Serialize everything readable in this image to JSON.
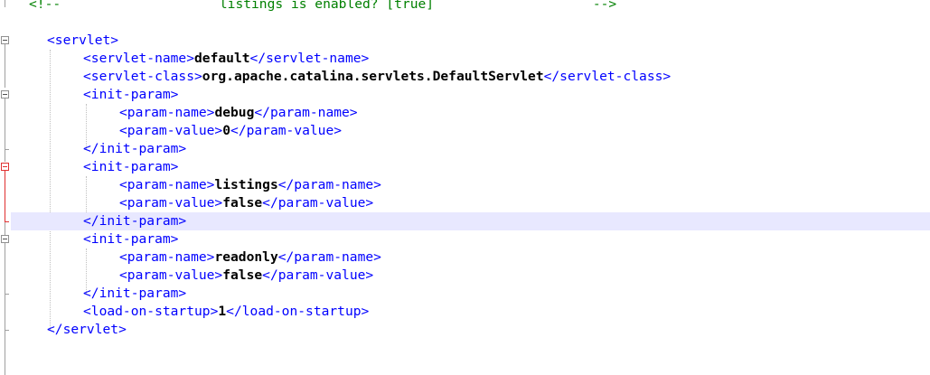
{
  "editor": {
    "current_line_color": "#e8e8ff",
    "colors": {
      "comment": "#008000",
      "tag": "#0000ff",
      "text": "#000000",
      "fold_marker_modified": "#e03030"
    },
    "lines": [
      {
        "comment": "<!--                    listings is enabled? [true]                    -->"
      },
      {},
      {
        "open": "<servlet>"
      },
      {
        "open": "<servlet-name>",
        "text": "default",
        "close": "</servlet-name>"
      },
      {
        "open": "<servlet-class>",
        "text": "org.apache.catalina.servlets.DefaultServlet",
        "close": "</servlet-class>"
      },
      {
        "open": "<init-param>"
      },
      {
        "open": "<param-name>",
        "text": "debug",
        "close": "</param-name>"
      },
      {
        "open": "<param-value>",
        "text": "0",
        "close": "</param-value>"
      },
      {
        "close": "</init-param>"
      },
      {
        "open": "<init-param>"
      },
      {
        "open": "<param-name>",
        "text": "listings",
        "close": "</param-name>"
      },
      {
        "open": "<param-value>",
        "text": "false",
        "close": "</param-value>"
      },
      {
        "close": "</init-param>"
      },
      {
        "open": "<init-param>"
      },
      {
        "open": "<param-name>",
        "text": "readonly",
        "close": "</param-name>"
      },
      {
        "open": "<param-value>",
        "text": "false",
        "close": "</param-value>"
      },
      {
        "close": "</init-param>"
      },
      {
        "open": "<load-on-startup>",
        "text": "1",
        "close": "</load-on-startup>"
      },
      {
        "close": "</servlet>"
      }
    ]
  }
}
